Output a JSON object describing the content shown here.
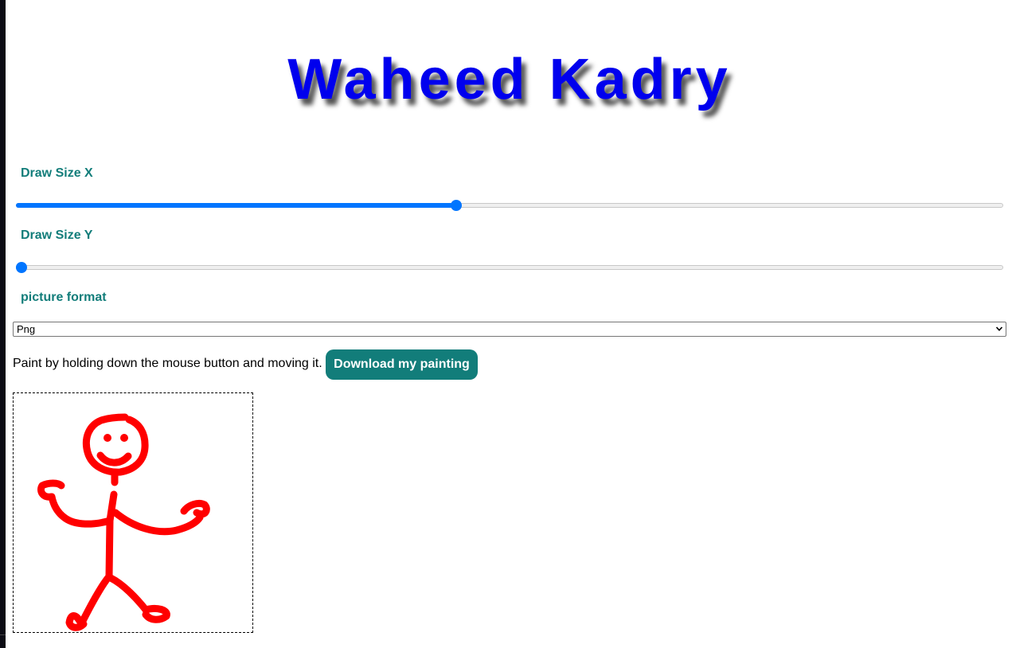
{
  "header": {
    "title": "Waheed Kadry"
  },
  "controls": {
    "draw_size_x": {
      "label": "Draw Size X",
      "value_fraction": 0.445
    },
    "draw_size_y": {
      "label": "Draw Size Y",
      "value_fraction": 0.0
    },
    "picture_format": {
      "label": "picture format",
      "selected": "Png"
    }
  },
  "paint_bar": {
    "instructions": "Paint by holding down the mouse button and moving it.",
    "download_label": "Download my painting"
  },
  "canvas": {
    "stroke_color": "#ff0000",
    "drawing": "stick-figure"
  },
  "colors": {
    "title": "#0000ee",
    "label": "#127d7a",
    "slider_accent": "#0075ff",
    "button_bg": "#127d7a"
  }
}
